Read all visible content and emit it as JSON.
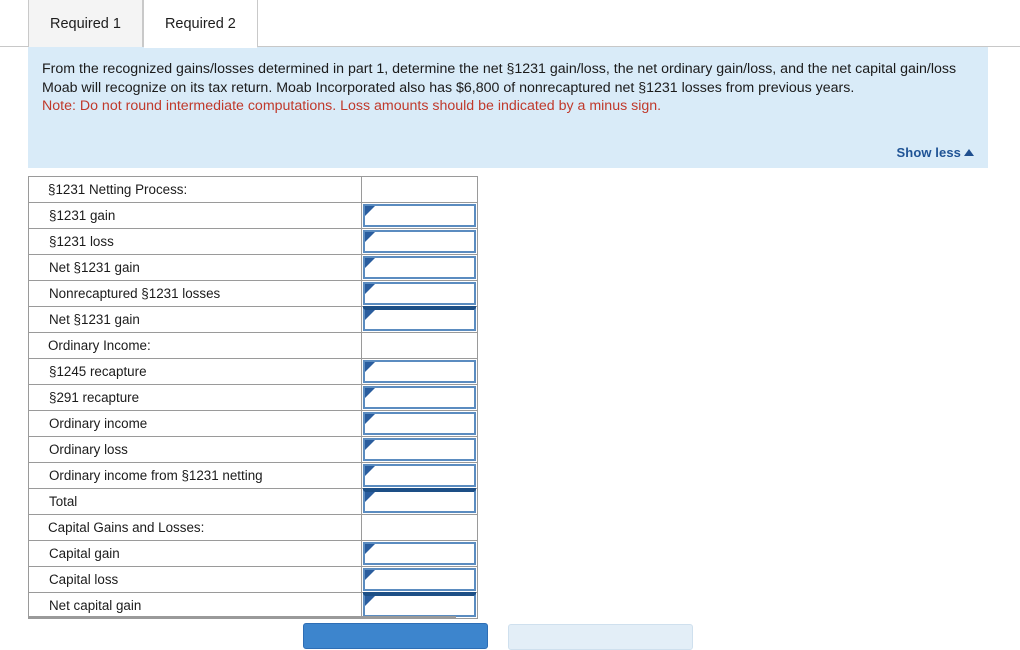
{
  "tabs": [
    {
      "label": "Required 1",
      "state": "inactive"
    },
    {
      "label": "Required 2",
      "state": "active"
    }
  ],
  "info": {
    "body": "From the recognized gains/losses determined in part 1, determine the net §1231 gain/loss, the net ordinary gain/loss, and the net capital gain/loss Moab will recognize on its tax return. Moab Incorporated also has $6,800 of nonrecaptured net §1231 losses from previous years.",
    "note": "Note: Do not round intermediate computations. Loss amounts should be indicated by a minus sign.",
    "show_less_label": "Show less",
    "show_less_icon": "caret-up-icon",
    "panel_color": "#d9ebf8",
    "note_color": "#c0392b",
    "link_color": "#1f5395"
  },
  "worksheet": {
    "rows": [
      {
        "label": "§1231 Netting Process:",
        "type": "section",
        "value": ""
      },
      {
        "label": "§1231 gain",
        "type": "input",
        "value": ""
      },
      {
        "label": "§1231 loss",
        "type": "input",
        "value": ""
      },
      {
        "label": "Net §1231 gain",
        "type": "input",
        "value": ""
      },
      {
        "label": "Nonrecaptured §1231 losses",
        "type": "input",
        "value": ""
      },
      {
        "label": "Net §1231 gain",
        "type": "input-total",
        "value": ""
      },
      {
        "label": "Ordinary Income:",
        "type": "section",
        "value": ""
      },
      {
        "label": "§1245 recapture",
        "type": "input",
        "value": ""
      },
      {
        "label": "§291 recapture",
        "type": "input",
        "value": ""
      },
      {
        "label": "Ordinary income",
        "type": "input",
        "value": ""
      },
      {
        "label": "Ordinary loss",
        "type": "input",
        "value": ""
      },
      {
        "label": "Ordinary income from §1231 netting",
        "type": "input",
        "value": ""
      },
      {
        "label": "Total",
        "type": "input-total",
        "value": ""
      },
      {
        "label": "Capital Gains and Losses:",
        "type": "section",
        "value": ""
      },
      {
        "label": "Capital gain",
        "type": "input",
        "value": ""
      },
      {
        "label": "Capital loss",
        "type": "input",
        "value": ""
      },
      {
        "label": "Net capital gain",
        "type": "input-total",
        "value": ""
      }
    ],
    "input_border_color": "#5b8cc0",
    "marker_color": "#2a5d9e"
  },
  "footer": {
    "primary_button_color": "#3d85cd",
    "secondary_button_color": "#e3eef7"
  }
}
